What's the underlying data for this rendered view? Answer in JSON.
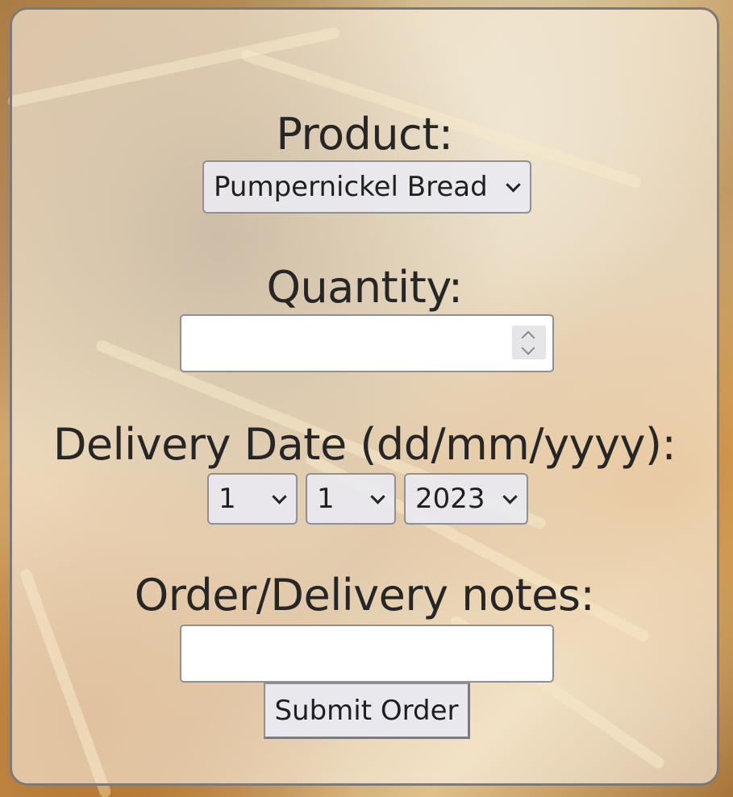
{
  "form": {
    "product_label": "Product:",
    "product_value": "Pumpernickel Bread",
    "quantity_label": "Quantity:",
    "quantity_value": "",
    "date_label": "Delivery Date (dd/mm/yyyy):",
    "day_value": "1",
    "month_value": "1",
    "year_value": "2023",
    "notes_label": "Order/Delivery notes:",
    "notes_value": "",
    "submit_label": "Submit Order"
  },
  "icons": {
    "dropdown": "chevron-down-icon",
    "spinner": "spinner-icon"
  },
  "colors": {
    "card_border": "#7a7a7a",
    "text": "#262626",
    "control_bg": "#e9e9f0",
    "input_bg": "#ffffff"
  }
}
